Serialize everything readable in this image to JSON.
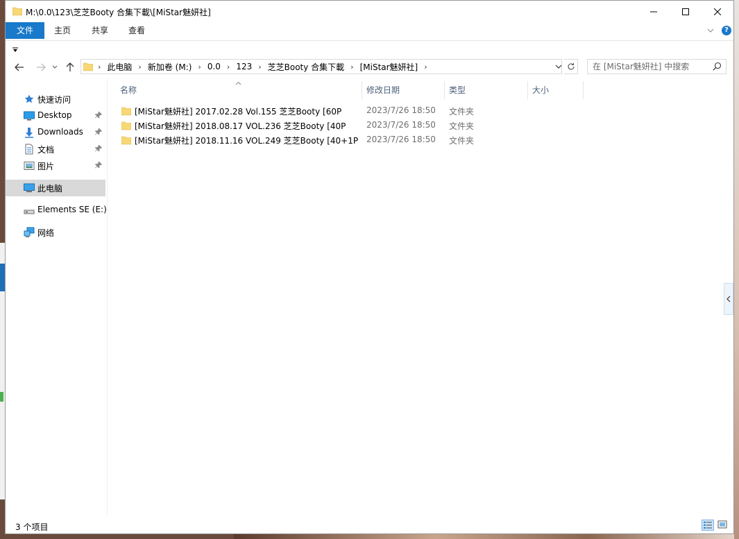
{
  "window": {
    "title": "M:\\0.0\\123\\芝芝Booty 合集下載\\[MiStar魅妍社]"
  },
  "ribbon": {
    "tabs": [
      "文件",
      "主页",
      "共享",
      "查看"
    ]
  },
  "address": {
    "crumbs": [
      "此电脑",
      "新加卷 (M:)",
      "0.0",
      "123",
      "芝芝Booty 合集下載",
      "[MiStar魅妍社]"
    ]
  },
  "search": {
    "placeholder": "在 [MiStar魅妍社] 中搜索"
  },
  "navpane": {
    "items": [
      {
        "label": "快速访问",
        "icon": "star-icon",
        "pinned": false
      },
      {
        "label": "Desktop",
        "icon": "desktop-icon",
        "pinned": true
      },
      {
        "label": "Downloads",
        "icon": "download-icon",
        "pinned": true
      },
      {
        "label": "文档",
        "icon": "document-icon",
        "pinned": true
      },
      {
        "label": "图片",
        "icon": "picture-icon",
        "pinned": true
      },
      {
        "label": "此电脑",
        "icon": "computer-icon",
        "pinned": false,
        "selected": true
      },
      {
        "label": "Elements SE (E:)",
        "icon": "drive-icon",
        "pinned": false
      },
      {
        "label": "网络",
        "icon": "network-icon",
        "pinned": false
      }
    ]
  },
  "columns": {
    "name": "名称",
    "date": "修改日期",
    "type": "类型",
    "size": "大小"
  },
  "files": [
    {
      "name": "[MiStar魅妍社] 2017.02.28 Vol.155 芝芝Booty [60P",
      "date": "2023/7/26 18:50",
      "type": "文件夹"
    },
    {
      "name": "[MiStar魅妍社] 2018.08.17 VOL.236 芝芝Booty [40P",
      "date": "2023/7/26 18:50",
      "type": "文件夹"
    },
    {
      "name": "[MiStar魅妍社] 2018.11.16 VOL.249 芝芝Booty [40+1P",
      "date": "2023/7/26 18:50",
      "type": "文件夹"
    }
  ],
  "status": {
    "count": "3 个项目"
  },
  "colors": {
    "accent": "#1979ca",
    "folder": "#f8d775",
    "header_text": "#4c607a"
  }
}
